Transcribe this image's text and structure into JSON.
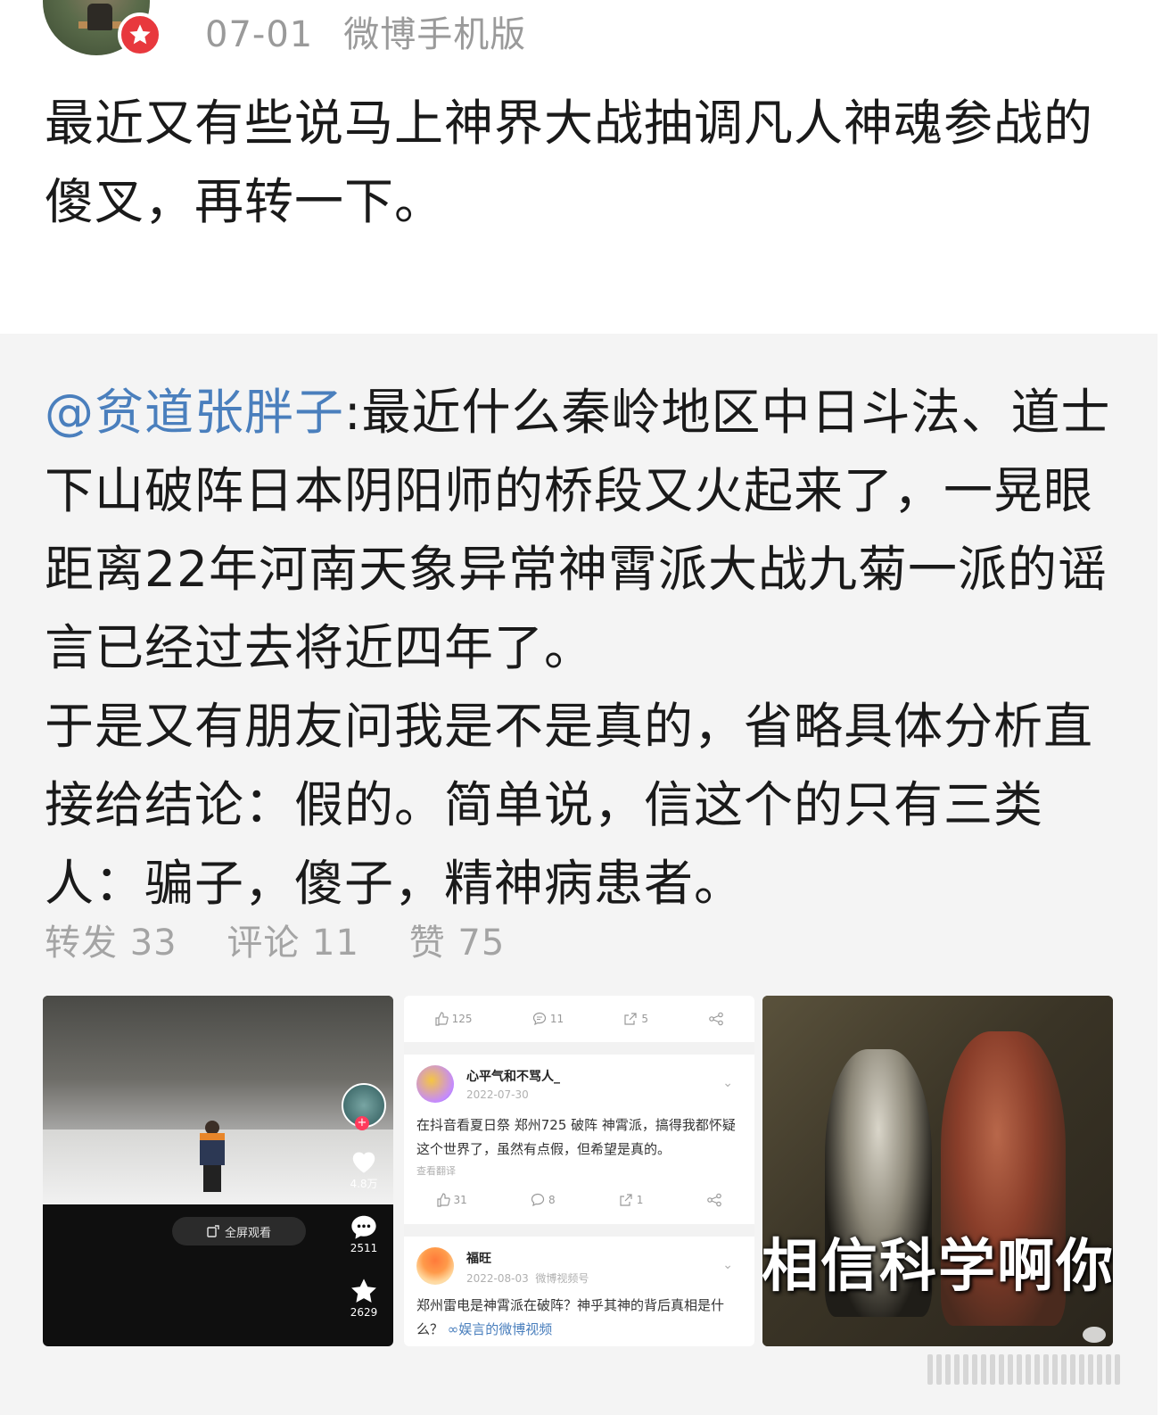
{
  "header": {
    "date": "07-01",
    "source": "微博手机版"
  },
  "post": {
    "text": "最近又有些说马上神界大战抽调凡人神魂参战的傻叉，再转一下。"
  },
  "repost": {
    "mention": "@贫道张胖子",
    "separator": ":",
    "body_lines": [
      "最近什么秦岭地区中日斗法、道士",
      "下山破阵日本阴阳师的桥段又火起来了，一晃眼",
      "距离22年河南天象异常神霄派大战九菊一派的谣",
      "言已经过去将近四年了。",
      "于是又有朋友问我是不是真的，省略具体分析直",
      "接给结论：假的。简单说，信这个的只有三类",
      "人：骗子，傻子，精神病患者。"
    ],
    "stats": {
      "repost": "转发 33",
      "comment": "评论 11",
      "like": "赞 75"
    }
  },
  "images": {
    "video": {
      "fullscreen_label": "全屏观看",
      "likes": "4.8万",
      "comments": "2511",
      "favorites": "2629"
    },
    "comments_shot": {
      "top_bar": {
        "likes": "125",
        "comments": "11",
        "shares": "5"
      },
      "comment1": {
        "name": "心平气和不骂人_",
        "date": "2022-07-30",
        "text": "在抖音看夏日祭 郑州725 破阵 神霄派，搞得我都怀疑这个世界了，虽然有点假，但希望是真的。",
        "translate": "查看翻译",
        "likes": "31",
        "comments": "8",
        "shares": "1"
      },
      "comment2": {
        "name": "福旺",
        "date": "2022-08-03",
        "source": "微博视频号",
        "text": "郑州雷电是神霄派在破阵？神乎其神的背后真相是什么？",
        "link": "娱言的微博视频"
      }
    },
    "meme": {
      "caption": "相信科学啊你"
    }
  },
  "colors": {
    "mention": "#4a7fbd",
    "verified_badge": "#e8383d",
    "meta_gray": "#9a9a9a",
    "repost_bg": "#f4f4f4"
  }
}
